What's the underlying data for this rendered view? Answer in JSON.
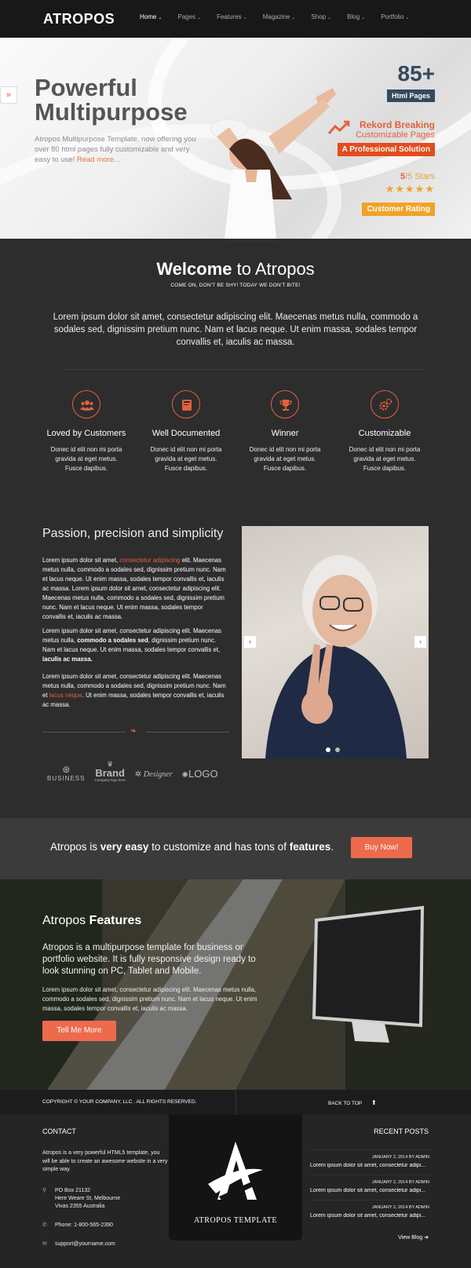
{
  "nav": {
    "logo": "ATROPOS",
    "items": [
      {
        "label": "Home"
      },
      {
        "label": "Pages"
      },
      {
        "label": "Features"
      },
      {
        "label": "Magazine"
      },
      {
        "label": "Shop"
      },
      {
        "label": "Blog"
      },
      {
        "label": "Portfolio"
      }
    ]
  },
  "hero": {
    "side_arrow": "»",
    "title_line1": "Powerful",
    "title_line2": "Multipurpose",
    "desc": "Atropos Multipurpose Template, now offering you over 80 html pages fully customizable and very easy to use!",
    "read_more": "Read more...",
    "stat_number": "85+",
    "stat_tag": "Html Pages",
    "rekord_title": "Rekord Breaking",
    "rekord_sub": "Customizable Pages",
    "professional": "A Professional Solution",
    "stars_value": "5",
    "stars_suffix": "/5 Stars",
    "stars_glyphs": "★★★★★",
    "customer_rating": "Customer Rating",
    "colors": {
      "navy": "#34495e",
      "orange": "#e2613c",
      "red": "#e44c1c",
      "gold": "#f0a326"
    }
  },
  "welcome": {
    "title_bold": "Welcome",
    "title_rest": " to Atropos",
    "subtitle": "COME ON, DON'T BE SHY! TODAY WE DON'T BITE!",
    "body": "Lorem ipsum dolor sit amet, consectetur adipiscing elit. Maecenas metus nulla, commodo a sodales sed, dignissim pretium nunc. Nam et lacus neque. Ut enim massa, sodales tempor convallis et, iaculis ac massa."
  },
  "features": [
    {
      "icon": "users-icon",
      "title": "Loved by Customers",
      "desc": "Donec id elit non mi porta gravida at eget metus. Fusce dapibus."
    },
    {
      "icon": "book-icon",
      "title": "Well Documented",
      "desc": "Donec id elit non mi porta gravida at eget metus. Fusce dapibus."
    },
    {
      "icon": "trophy-icon",
      "title": "Winner",
      "desc": "Donec id elit non mi porta gravida at eget metus. Fusce dapibus."
    },
    {
      "icon": "gears-icon",
      "title": "Customizable",
      "desc": "Donec id elit non mi porta gravida at eget metus. Fusce dapibus."
    }
  ],
  "passion": {
    "title": "Passion, precision and simplicity",
    "p1_a": "Lorem ipsum dolor sit amet, ",
    "p1_link": "consectetur adipiscing",
    "p1_b": " elit. Maecenas metus nulla, commodo a sodales sed, dignissim pretium nunc. Nam et lacus neque. Ut enim massa, sodales tempor convallis et, iaculis ac massa. Lorem ipsum dolor sit amet, consectetur adipiscing elit. Maecenas metus nulla, commodo a sodales sed, dignissim pretium nunc. Nam et lacus neque. Ut enim massa, sodales tempor convallis et, iaculis ac massa.",
    "p2_a": "Lorem ipsum dolor sit amet, consectetur adipiscing elit. Maecenas metus nulla, ",
    "p2_bold": "commodo a sodales sed",
    "p2_b": ", dignissim pretium nunc. Nam et lacus neque. Ut enim massa, sodales tempor convallis et, ",
    "p2_bold2": "iaculis ac massa.",
    "p3_a": "Lorem ipsum dolor sit amet, consectetur adipiscing elit. Maecenas metus nulla, commodo a sodales sed, dignissim pretium nunc. Nam et ",
    "p3_link": "lacus neque",
    "p3_b": ". Ut enim massa, sodales tempor convallis et, iaculis ac massa.",
    "logos": [
      "BUSINESS",
      "Brand",
      "Designer",
      "LOGO"
    ],
    "brand_sub": "Company logo here",
    "prev": "‹",
    "next": "›"
  },
  "cta": {
    "text_a": "Atropos is ",
    "text_bold1": "very easy",
    "text_b": " to customize and has tons of ",
    "text_bold2": "features",
    "text_c": ".",
    "button": "Buy Now!"
  },
  "band": {
    "title_a": "Atropos ",
    "title_bold": "Features",
    "lead": "Atropos is a multipurpose template for business or portfolio website. It is fully responsive design ready to look stunning on PC, Tablet and Mobile.",
    "body": "Lorem ipsum dolor sit amet, consectetur adipiscing elit. Maecenas metus nulla, commodo a sodales sed, dignissim pretium nunc. Nam et lacus neque. Ut enim massa, sodales tempor convallis et, iaculis ac massa.",
    "button": "Tell Me More"
  },
  "copyright": {
    "text": "COPYRIGHT © YOUR COMPANY, LLC . ALL RIGHTS RESERVED.",
    "back_to_top": "BACK TO TOP"
  },
  "footer": {
    "contact_heading": "CONTACT",
    "contact_desc": "Atropos is a very powerful HTML5 template, you will be able to create an awesome website in a very simple way.",
    "address1": "PO Box 21132",
    "address2": "Here Weare St, Melbourne",
    "address3": "Vivas 2355 Australia",
    "phone": "Phone: 1-800-565-2390",
    "email": "support@yourname.com",
    "logo_caption": "ATROPOS TEMPLATE",
    "recent_heading": "RECENT POSTS",
    "posts": [
      {
        "meta": "JANUARY 2, 2014 BY ADMIN",
        "title": "Lorem ipsum dolor sit amet, consectetur adipi..."
      },
      {
        "meta": "JANUARY 2, 2014 BY ADMIN",
        "title": "Lorem ipsum dolor sit amet, consectetur adipi..."
      },
      {
        "meta": "JANUARY 2, 2014 BY ADMIN",
        "title": "Lorem ipsum dolor sit amet, consectetur adipi..."
      }
    ],
    "view_blog": "View Blog"
  }
}
